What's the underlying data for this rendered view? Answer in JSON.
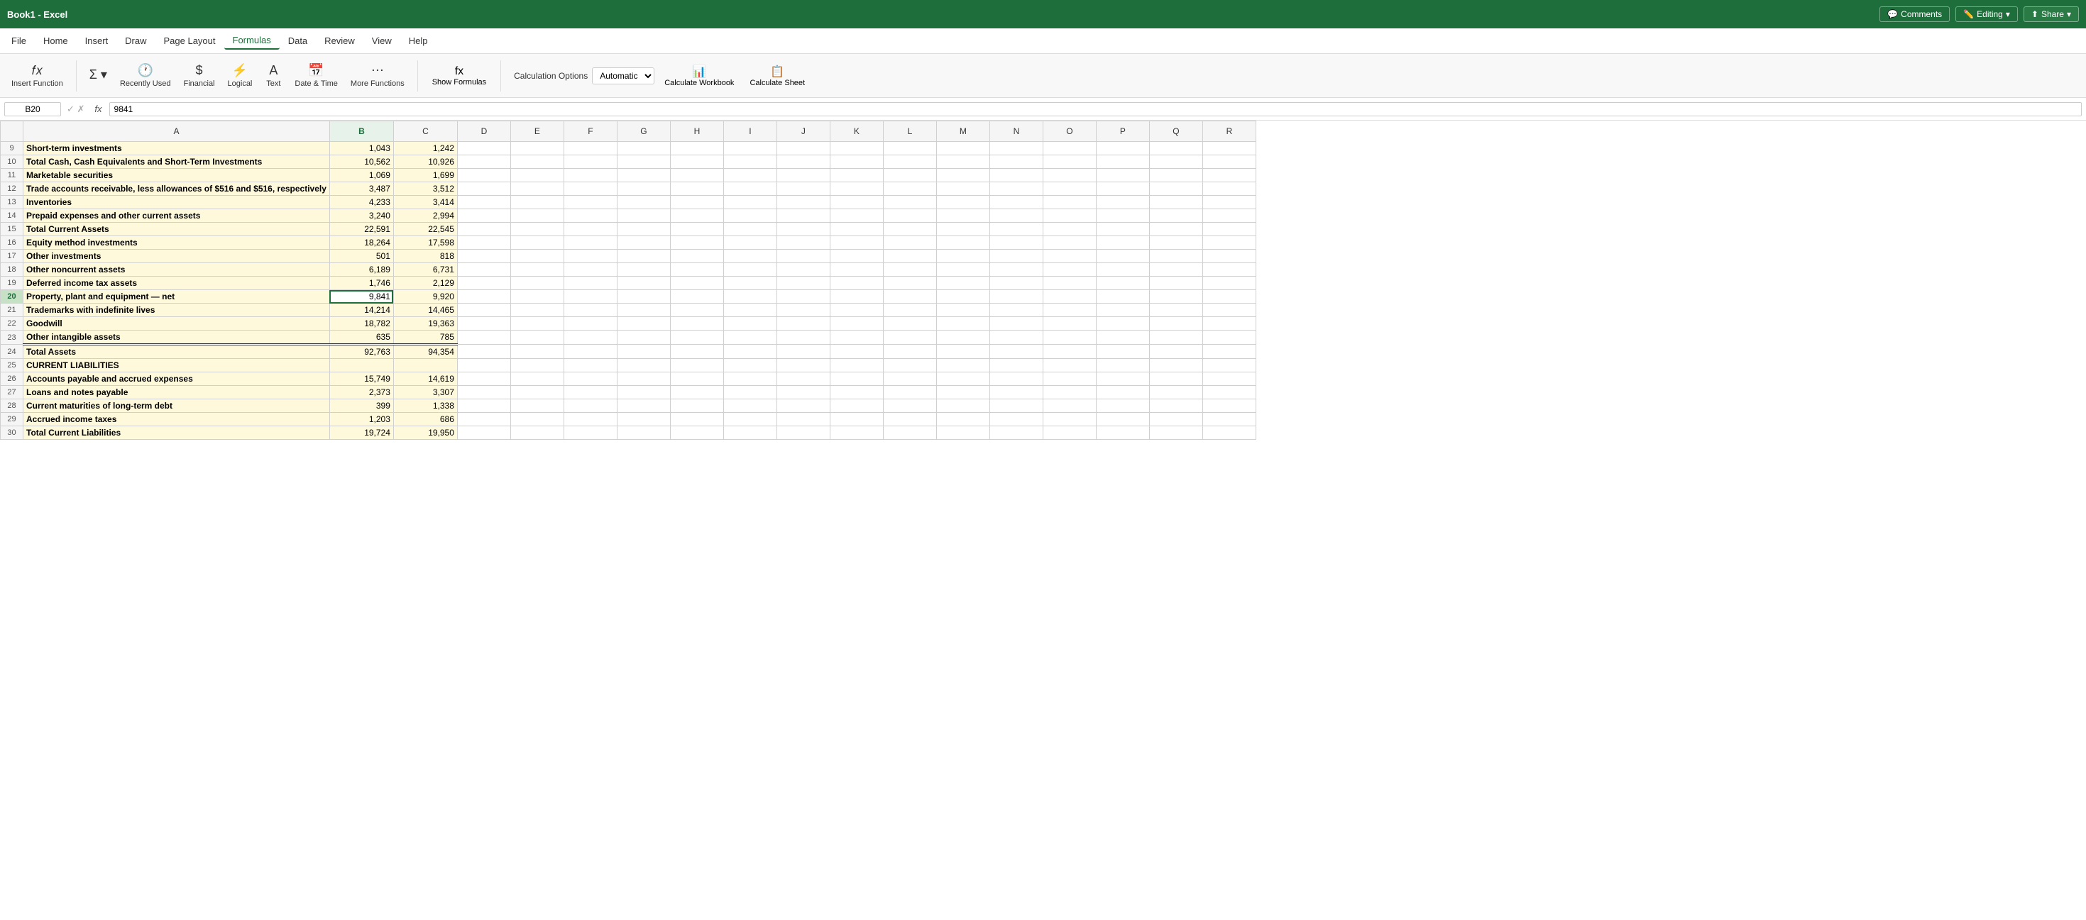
{
  "titlebar": {
    "filename": "Book1 - Excel",
    "editing_label": "Editing",
    "comments_label": "Comments",
    "share_label": "Share"
  },
  "menu": {
    "items": [
      "File",
      "Home",
      "Insert",
      "Draw",
      "Page Layout",
      "Formulas",
      "Data",
      "Review",
      "View",
      "Help"
    ],
    "active": "Formulas"
  },
  "ribbon": {
    "insert_function_label": "Insert Function",
    "autosum_label": "AutoSum",
    "recently_used_label": "Recently Used",
    "financial_label": "Financial",
    "logical_label": "Logical",
    "text_label": "Text",
    "date_time_label": "Date & Time",
    "more_functions_label": "More Functions",
    "show_formulas_label": "Show Formulas",
    "calc_options_label": "Calculation Options",
    "calc_options_value": "Automatic",
    "calc_workbook_label": "Calculate Workbook",
    "calc_sheet_label": "Calculate Sheet"
  },
  "formula_bar": {
    "cell_ref": "B20",
    "formula": "9841"
  },
  "columns": {
    "row_header": "",
    "headers": [
      "A",
      "B",
      "C",
      "D",
      "E",
      "F",
      "G",
      "H",
      "I",
      "J",
      "K",
      "L",
      "M",
      "N",
      "O",
      "P",
      "Q",
      "R"
    ],
    "selected_col": "B"
  },
  "rows": [
    {
      "num": "9",
      "a": "Short-term investments",
      "b": "1,043",
      "c": "1,242",
      "label": true,
      "highlight": true
    },
    {
      "num": "10",
      "a": "Total Cash, Cash Equivalents and Short-Term Investments",
      "b": "10,562",
      "c": "10,926",
      "label": true,
      "highlight": true
    },
    {
      "num": "11",
      "a": "Marketable securities",
      "b": "1,069",
      "c": "1,699",
      "label": true,
      "highlight": true
    },
    {
      "num": "12",
      "a": "Trade accounts receivable, less allowances of $516 and $516, respectively",
      "b": "3,487",
      "c": "3,512",
      "label": true,
      "highlight": true
    },
    {
      "num": "13",
      "a": "Inventories",
      "b": "4,233",
      "c": "3,414",
      "label": true,
      "highlight": true
    },
    {
      "num": "14",
      "a": "Prepaid expenses and other current assets",
      "b": "3,240",
      "c": "2,994",
      "label": true,
      "highlight": true
    },
    {
      "num": "15",
      "a": "Total Current Assets",
      "b": "22,591",
      "c": "22,545",
      "label": true,
      "highlight": true
    },
    {
      "num": "16",
      "a": "Equity method investments",
      "b": "18,264",
      "c": "17,598",
      "label": true,
      "highlight": true
    },
    {
      "num": "17",
      "a": "Other investments",
      "b": "501",
      "c": "818",
      "label": true,
      "highlight": true
    },
    {
      "num": "18",
      "a": "Other noncurrent assets",
      "b": "6,189",
      "c": "6,731",
      "label": true,
      "highlight": true
    },
    {
      "num": "19",
      "a": "Deferred income tax assets",
      "b": "1,746",
      "c": "2,129",
      "label": true,
      "highlight": true
    },
    {
      "num": "20",
      "a": "Property, plant and equipment — net",
      "b": "9,841",
      "c": "9,920",
      "label": true,
      "highlight": true,
      "selected": true
    },
    {
      "num": "21",
      "a": "Trademarks with indefinite lives",
      "b": "14,214",
      "c": "14,465",
      "label": true,
      "highlight": true
    },
    {
      "num": "22",
      "a": "Goodwill",
      "b": "18,782",
      "c": "19,363",
      "label": true,
      "highlight": true
    },
    {
      "num": "23",
      "a": "Other intangible assets",
      "b": "635",
      "c": "785",
      "label": true,
      "highlight": true,
      "border_top": true
    },
    {
      "num": "24",
      "a": "Total Assets",
      "b": "92,763",
      "c": "94,354",
      "label": true,
      "highlight": true,
      "border_top_double": true
    },
    {
      "num": "25",
      "a": "CURRENT LIABILITIES",
      "b": "",
      "c": "",
      "section": true,
      "highlight": true
    },
    {
      "num": "26",
      "a": "Accounts payable and accrued expenses",
      "b": "15,749",
      "c": "14,619",
      "label": true,
      "highlight": true
    },
    {
      "num": "27",
      "a": "Loans and notes payable",
      "b": "2,373",
      "c": "3,307",
      "label": true,
      "highlight": true
    },
    {
      "num": "28",
      "a": "Current maturities of long-term debt",
      "b": "399",
      "c": "1,338",
      "label": true,
      "highlight": true
    },
    {
      "num": "29",
      "a": "Accrued income taxes",
      "b": "1,203",
      "c": "686",
      "label": true,
      "highlight": true
    },
    {
      "num": "30",
      "a": "Total Current Liabilities",
      "b": "19,724",
      "c": "19,950",
      "label": true,
      "highlight": true
    }
  ],
  "colors": {
    "highlight_bg": "#fff9db",
    "selected_cell_border": "#1e6e3c",
    "header_bg": "#f5f5f5",
    "active_menu_color": "#1e6e3c",
    "title_bar_bg": "#1e6e3c",
    "share_btn_bg": "#2a8a4e"
  }
}
